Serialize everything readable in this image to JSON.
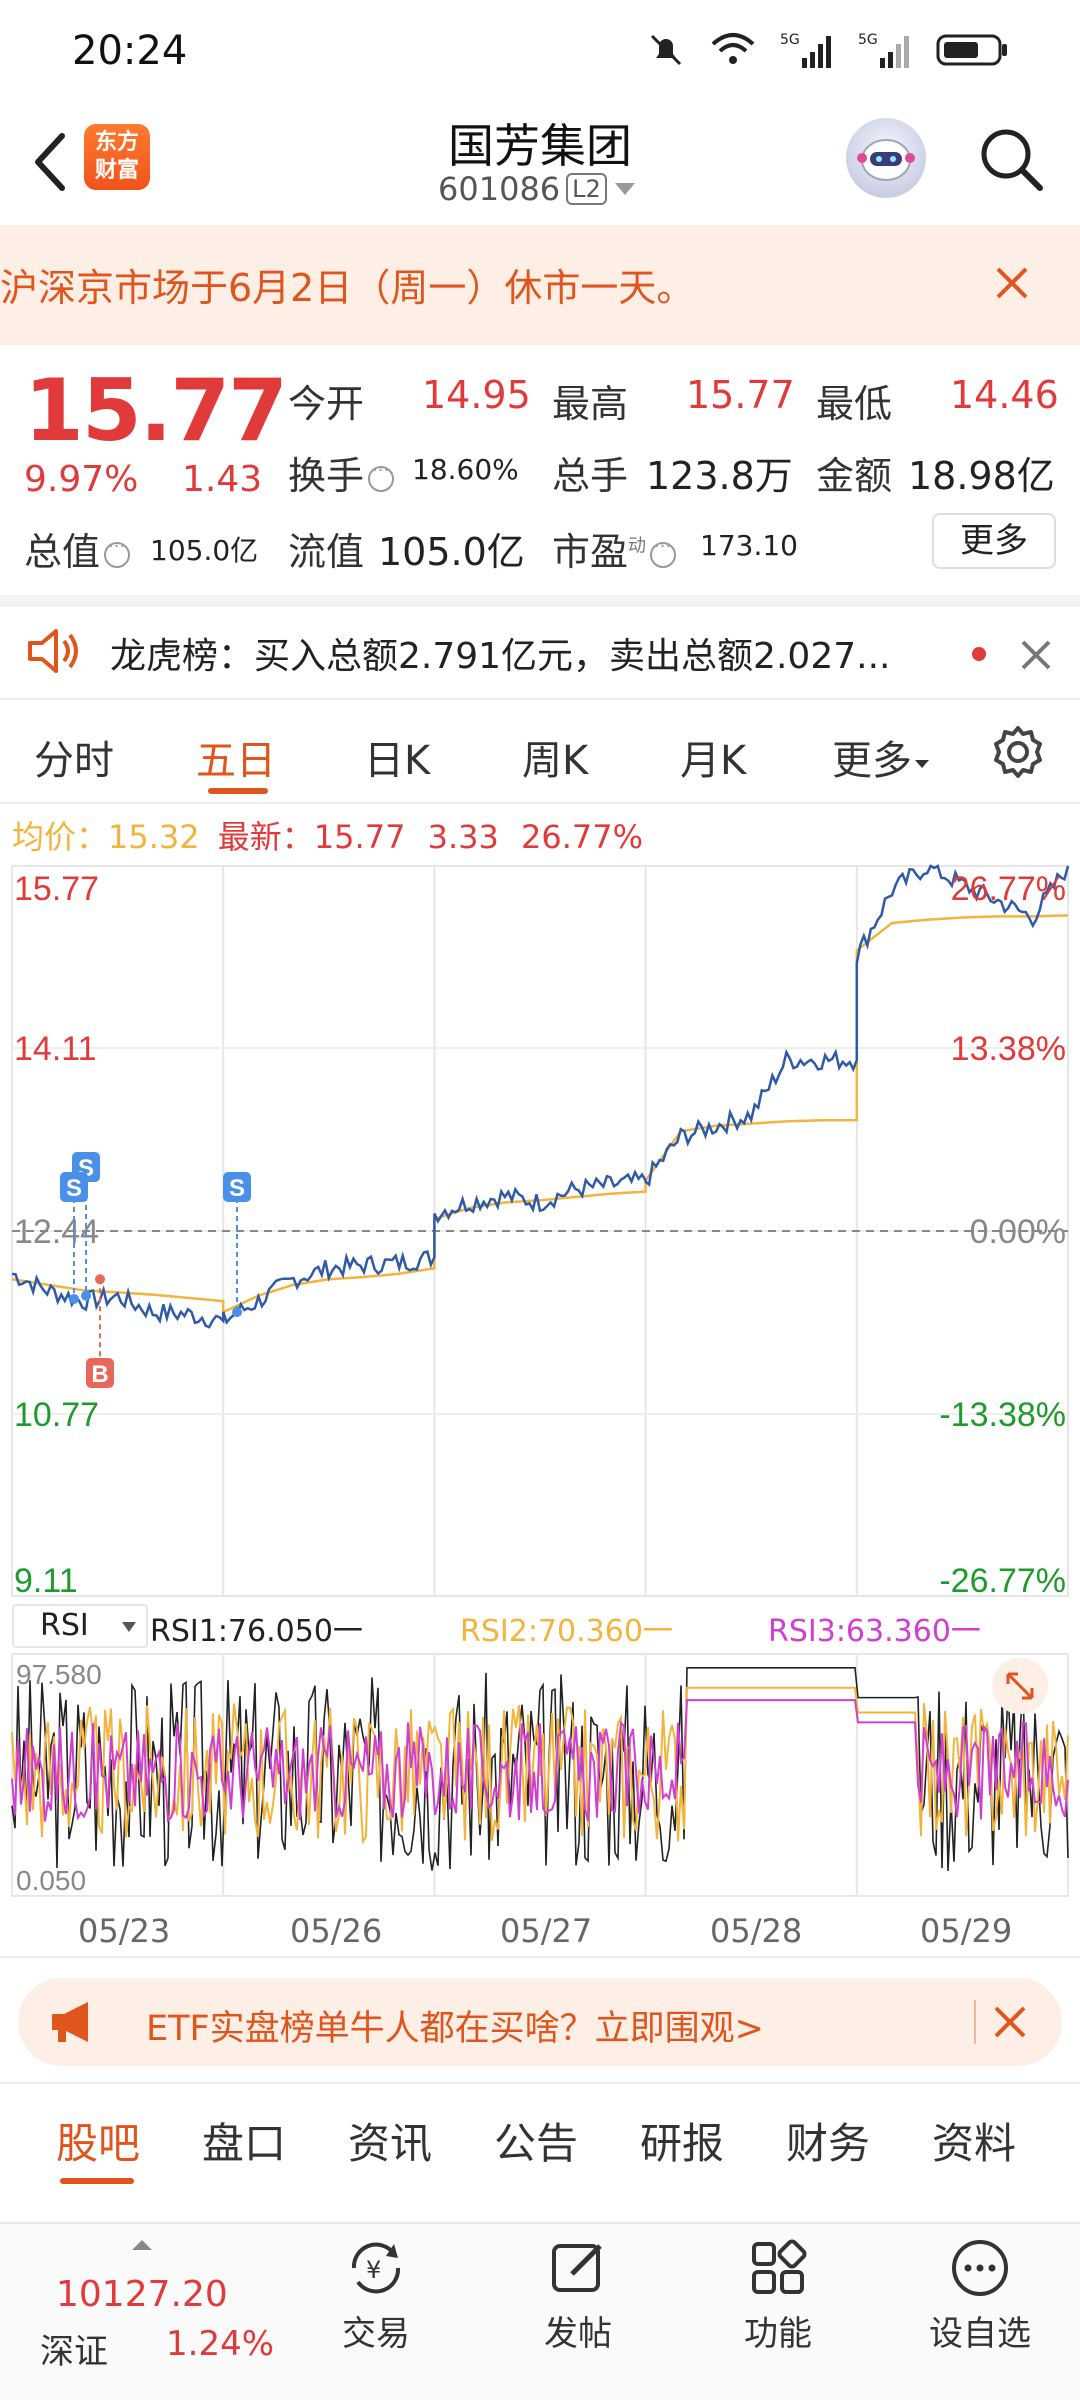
{
  "status_bar": {
    "time": "20:24"
  },
  "header": {
    "stock_name": "国芳集团",
    "stock_code": "601086",
    "l2_badge": "L2",
    "logo_line1": "东方",
    "logo_line2": "财富"
  },
  "notice": {
    "text": "沪深京市场于6月2日（周一）休市一天。"
  },
  "quote": {
    "price": "15.77",
    "change_pct": "9.97%",
    "change_val": "1.43",
    "open_label": "今开",
    "open": "14.95",
    "high_label": "最高",
    "high": "15.77",
    "low_label": "最低",
    "low": "14.46",
    "turnover_label": "换手",
    "turnover": "18.60%",
    "volume_label": "总手",
    "volume": "123.8万",
    "amount_label": "金额",
    "amount": "18.98亿",
    "mktcap_label": "总值",
    "mktcap": "105.0亿",
    "float_label": "流值",
    "float_cap": "105.0亿",
    "pe_label": "市盈",
    "pe_sup": "动",
    "pe": "173.10",
    "more_button": "更多"
  },
  "dragon_tiger": {
    "text": "龙虎榜：买入总额2.791亿元，卖出总额2.027..."
  },
  "chart_tabs": [
    "分时",
    "五日",
    "日K",
    "周K",
    "月K",
    "更多"
  ],
  "active_chart_tab": "五日",
  "price_info": {
    "avg_label": "均价：",
    "avg": "15.32",
    "latest_label": "最新：",
    "latest": "15.77",
    "change": "3.33",
    "change_pct": "26.77%"
  },
  "chart_data": [
    {
      "type": "line",
      "x": [
        "05/23",
        "05/26",
        "05/27",
        "05/28",
        "05/29"
      ],
      "series": [
        {
          "name": "均价",
          "color": "#f2b43c"
        }
      ],
      "y_ticks_left": [
        "15.77",
        "14.11",
        "12.44",
        "10.77",
        "9.11"
      ],
      "y_ticks_right": [
        "26.77%",
        "13.38%",
        "0.00%",
        "-13.38%",
        "-26.77%"
      ],
      "ylim": [
        9.11,
        15.77
      ],
      "prev_close": 12.44,
      "day_points": [
        [
          12.05,
          11.9,
          11.8,
          11.84,
          11.7,
          11.68,
          11.62
        ],
        [
          11.62,
          11.8,
          12.0,
          12.1,
          12.13,
          12.15,
          12.2
        ],
        [
          12.6,
          12.7,
          12.76,
          12.7,
          12.82,
          12.86,
          12.9
        ],
        [
          12.9,
          13.3,
          13.4,
          13.5,
          14.0,
          14.0,
          14.0
        ],
        [
          14.95,
          15.55,
          15.77,
          15.6,
          15.45,
          15.3,
          15.77
        ]
      ],
      "avg_points": [
        [
          12.0,
          11.95,
          11.9,
          11.88,
          11.86,
          11.83,
          11.8
        ],
        [
          11.7,
          11.85,
          11.95,
          12.0,
          12.02,
          12.05,
          12.1
        ],
        [
          12.55,
          12.65,
          12.7,
          12.72,
          12.75,
          12.78,
          12.8
        ],
        [
          12.9,
          13.35,
          13.4,
          13.42,
          13.44,
          13.45,
          13.45
        ],
        [
          15.0,
          15.25,
          15.28,
          15.3,
          15.31,
          15.31,
          15.32
        ]
      ],
      "markers": [
        {
          "label": "S",
          "type": "sell"
        },
        {
          "label": "S",
          "type": "sell"
        },
        {
          "label": "B",
          "type": "buy"
        },
        {
          "label": "S",
          "type": "sell"
        }
      ]
    },
    {
      "type": "line",
      "indicator": "RSI",
      "x": [
        "05/23",
        "05/26",
        "05/27",
        "05/28",
        "05/29"
      ],
      "ylim": [
        0.05,
        97.58
      ],
      "y_ticks": [
        "97.580",
        "0.050"
      ],
      "series": [
        {
          "name": "RSI1",
          "value": "76.050",
          "color": "#222222"
        },
        {
          "name": "RSI2",
          "value": "70.360",
          "color": "#f2b43c"
        },
        {
          "name": "RSI3",
          "value": "63.360",
          "color": "#d03fd0"
        }
      ]
    }
  ],
  "rsi_header": {
    "selector": "RSI",
    "rsi1": "RSI1:76.050一",
    "rsi2": "RSI2:70.360一",
    "rsi3": "RSI3:63.360一"
  },
  "etf_banner": {
    "text": "ETF实盘榜单牛人都在买啥？立即围观>"
  },
  "bottom_tabs": [
    "股吧",
    "盘口",
    "资讯",
    "公告",
    "研报",
    "财务",
    "资料"
  ],
  "nav_bar": {
    "index_value": "10127.20",
    "index_name": "深证",
    "index_pct": "1.24%",
    "trade": "交易",
    "post": "发帖",
    "functions": "功能",
    "add_watch": "设自选"
  }
}
